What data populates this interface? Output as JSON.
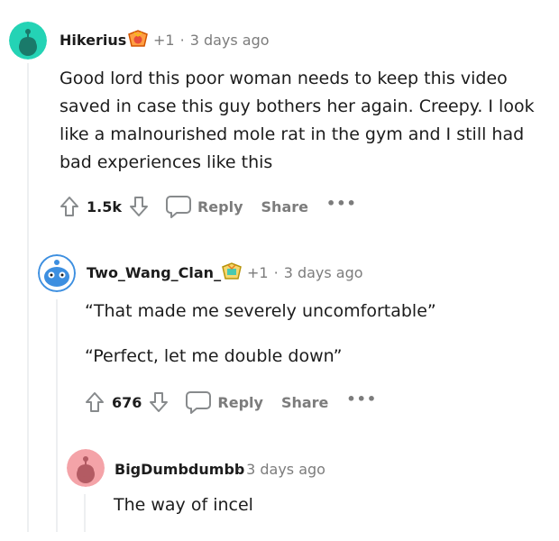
{
  "comments": [
    {
      "username": "Hikerius",
      "points": "+1",
      "time": "3 days ago",
      "body": [
        "Good lord this poor woman needs to keep this video saved in case this guy bothers her again. Creepy. I look like a malnourished mole rat in the gym and I still had bad experiences like this"
      ],
      "score": "1.5k",
      "reply_label": "Reply",
      "share_label": "Share",
      "more_label": "•••",
      "avatar_color": "#24d3b5"
    },
    {
      "username": "Two_Wang_Clan_",
      "points": "+1",
      "time": "3 days ago",
      "body": [
        "“That made me severely uncomfortable”",
        "“Perfect, let me double down”"
      ],
      "score": "676",
      "reply_label": "Reply",
      "share_label": "Share",
      "more_label": "•••",
      "avatar_color": "#3d8fe0"
    },
    {
      "username": "BigDumbdumbb",
      "time": "3 days ago",
      "body": [
        "The way of incel"
      ],
      "avatar_color": "#f4a3a8"
    }
  ],
  "colors": {
    "text": "#1c1c1c",
    "meta": "#7c7c7c",
    "thread_line": "#edeff1"
  },
  "icons": [
    "upvote-icon",
    "downvote-icon",
    "comment-bubble-icon",
    "award-flair-icon"
  ]
}
